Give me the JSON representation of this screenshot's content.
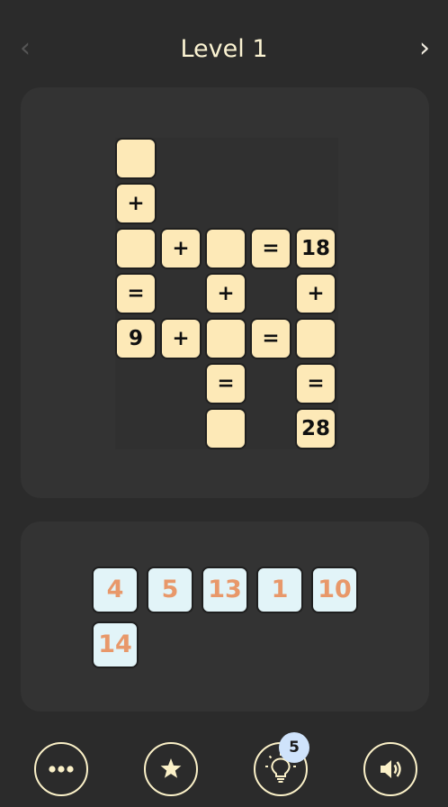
{
  "header": {
    "title": "Level 1",
    "prev_glyph": "‹",
    "next_glyph": "›",
    "prev_icon": "chevron-left-icon",
    "next_icon": "chevron-right-icon"
  },
  "board": {
    "rows": [
      [
        "",
        null,
        null,
        null,
        null
      ],
      [
        "+",
        null,
        null,
        null,
        null
      ],
      [
        "",
        "+",
        "",
        "=",
        "18"
      ],
      [
        "=",
        null,
        "+",
        null,
        "+"
      ],
      [
        "9",
        "+",
        "",
        "=",
        ""
      ],
      [
        null,
        null,
        "=",
        null,
        "="
      ],
      [
        null,
        null,
        "",
        null,
        "28"
      ]
    ]
  },
  "tray": {
    "tiles": [
      "4",
      "5",
      "13",
      "1",
      "10",
      "14"
    ]
  },
  "controls": {
    "hint_count": "5",
    "icons": [
      "more-icon",
      "star-icon",
      "lightbulb-icon",
      "speaker-icon"
    ]
  },
  "colors": {
    "background": "#2b2b2b",
    "panel": "#333333",
    "cell_fill": "#fde9b7",
    "tile_fill": "#e2f4f8",
    "tile_text": "#e8986a",
    "title_text": "#fbf3d2",
    "badge_fill": "#cfe3fb"
  }
}
